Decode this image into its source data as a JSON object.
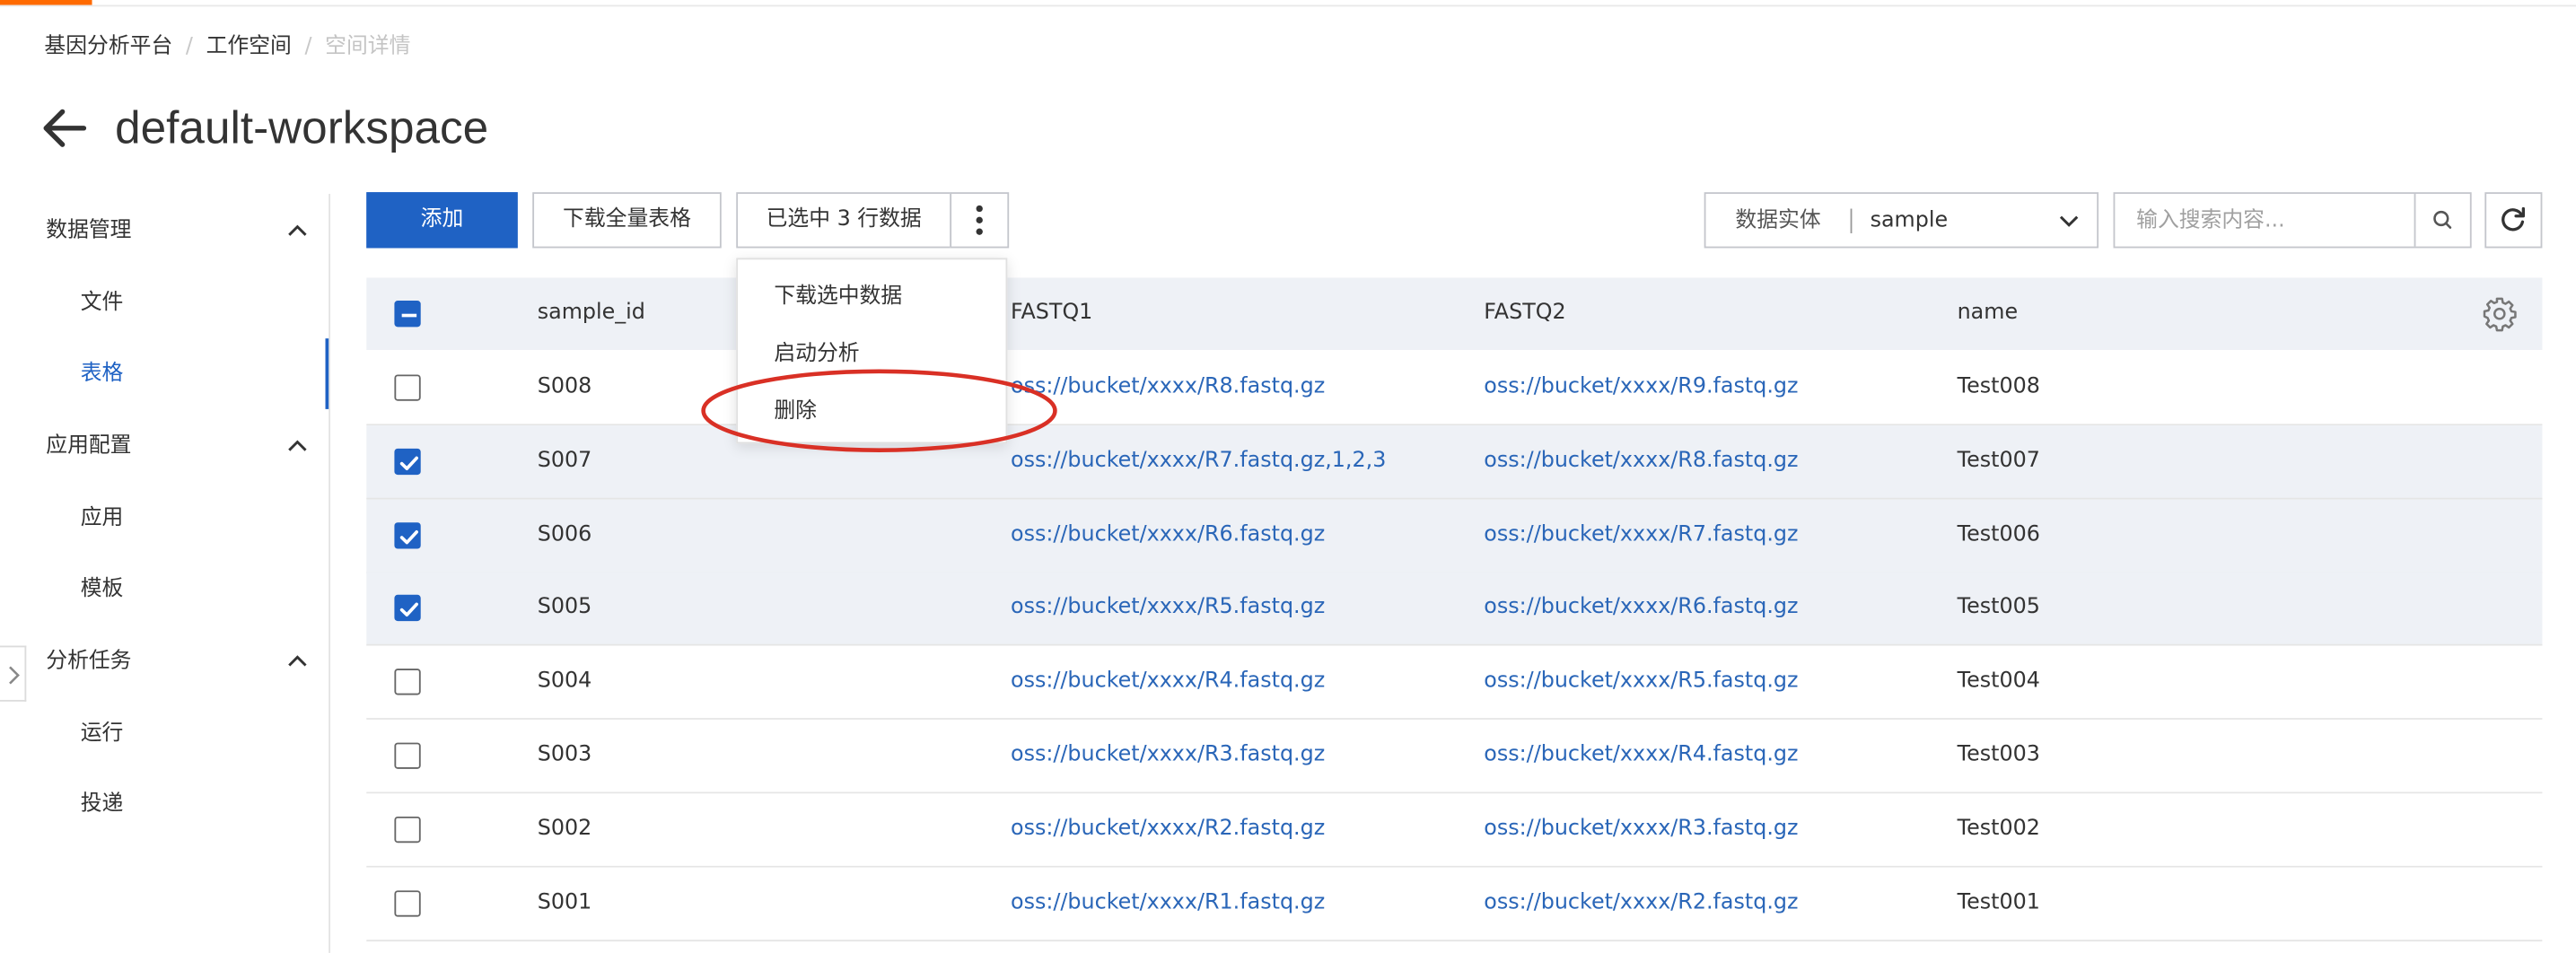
{
  "breadcrumb": [
    "基因分析平台",
    "工作空间",
    "空间详情"
  ],
  "page_title": "default-workspace",
  "sidebar": {
    "groups": [
      {
        "label": "数据管理",
        "items": [
          "文件",
          "表格"
        ]
      },
      {
        "label": "应用配置",
        "items": [
          "应用",
          "模板"
        ]
      },
      {
        "label": "分析任务",
        "items": [
          "运行",
          "投递"
        ]
      }
    ],
    "active_item": "表格"
  },
  "toolbar": {
    "add_label": "添加",
    "download_all_label": "下载全量表格",
    "selected_label": "已选中 3 行数据",
    "more_icon": "more-vertical-icon"
  },
  "dropdown_menu": {
    "items": [
      "下载选中数据",
      "启动分析",
      "删除"
    ],
    "highlighted_item": "删除",
    "highlight_color": "#d93025"
  },
  "entity_select": {
    "label": "数据实体",
    "value": "sample"
  },
  "search": {
    "placeholder": "输入搜索内容..."
  },
  "table": {
    "columns": [
      "sample_id",
      "FASTQ1",
      "FASTQ2",
      "name"
    ],
    "header_checkbox": "indeterminate",
    "rows": [
      {
        "sample_id": "S008",
        "fastq1": "oss://bucket/xxxx/R8.fastq.gz",
        "fastq2": "oss://bucket/xxxx/R9.fastq.gz",
        "name": "Test008",
        "checked": false
      },
      {
        "sample_id": "S007",
        "fastq1": "oss://bucket/xxxx/R7.fastq.gz,1,2,3",
        "fastq2": "oss://bucket/xxxx/R8.fastq.gz",
        "name": "Test007",
        "checked": true
      },
      {
        "sample_id": "S006",
        "fastq1": "oss://bucket/xxxx/R6.fastq.gz",
        "fastq2": "oss://bucket/xxxx/R7.fastq.gz",
        "name": "Test006",
        "checked": true
      },
      {
        "sample_id": "S005",
        "fastq1": "oss://bucket/xxxx/R5.fastq.gz",
        "fastq2": "oss://bucket/xxxx/R6.fastq.gz",
        "name": "Test005",
        "checked": true
      },
      {
        "sample_id": "S004",
        "fastq1": "oss://bucket/xxxx/R4.fastq.gz",
        "fastq2": "oss://bucket/xxxx/R5.fastq.gz",
        "name": "Test004",
        "checked": false
      },
      {
        "sample_id": "S003",
        "fastq1": "oss://bucket/xxxx/R3.fastq.gz",
        "fastq2": "oss://bucket/xxxx/R4.fastq.gz",
        "name": "Test003",
        "checked": false
      },
      {
        "sample_id": "S002",
        "fastq1": "oss://bucket/xxxx/R2.fastq.gz",
        "fastq2": "oss://bucket/xxxx/R3.fastq.gz",
        "name": "Test002",
        "checked": false
      },
      {
        "sample_id": "S001",
        "fastq1": "oss://bucket/xxxx/R1.fastq.gz",
        "fastq2": "oss://bucket/xxxx/R2.fastq.gz",
        "name": "Test001",
        "checked": false
      }
    ]
  },
  "colors": {
    "primary": "#1f62c4",
    "link": "#2a66b8",
    "accent": "#ff6a00",
    "selected_row": "#eef1f6"
  }
}
